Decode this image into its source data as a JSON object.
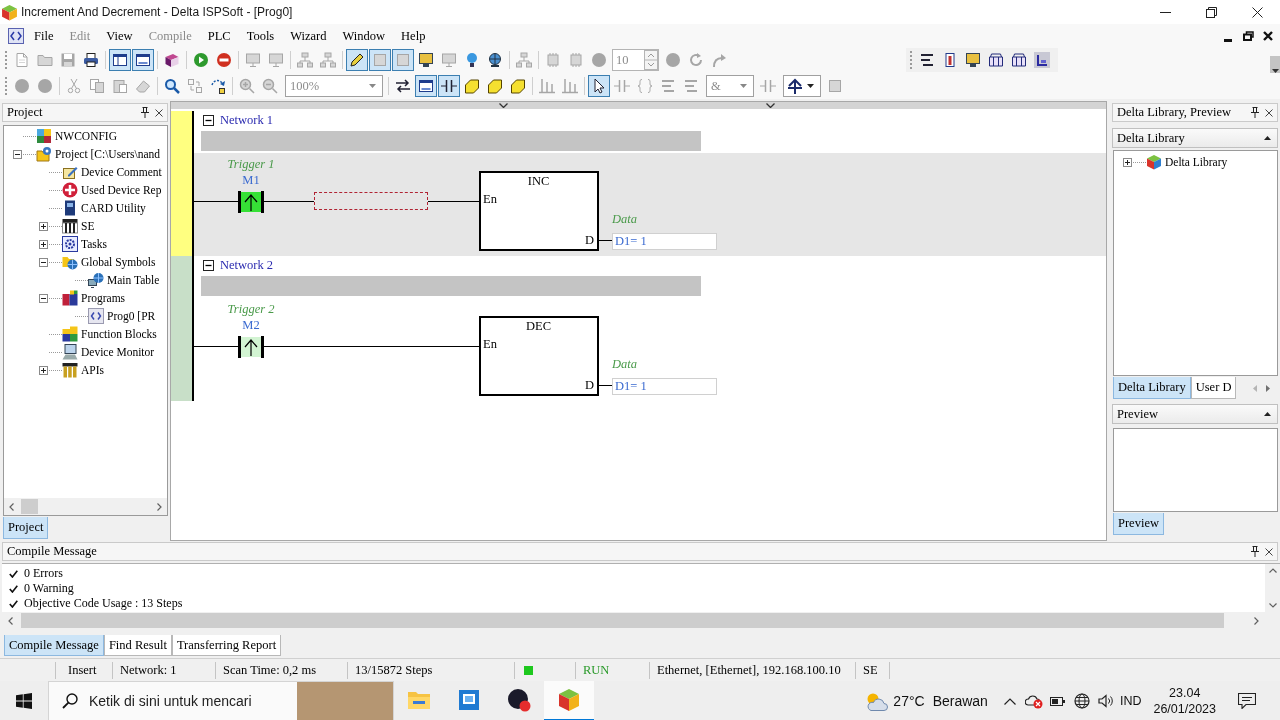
{
  "window": {
    "title": "Increment And Decrement - Delta ISPSoft - [Prog0]"
  },
  "menu": [
    {
      "label": "File",
      "disabled": false
    },
    {
      "label": "Edit",
      "disabled": true
    },
    {
      "label": "View",
      "disabled": false
    },
    {
      "label": "Compile",
      "disabled": true
    },
    {
      "label": "PLC",
      "disabled": false
    },
    {
      "label": "Tools",
      "disabled": false
    },
    {
      "label": "Wizard",
      "disabled": false
    },
    {
      "label": "Window",
      "disabled": false
    },
    {
      "label": "Help",
      "disabled": false
    }
  ],
  "toolbar_rows": [
    {
      "groups": [
        {
          "items": [
            {
              "kind": "button",
              "disabled": true,
              "selected": false
            },
            {
              "kind": "button",
              "disabled": true,
              "selected": false
            },
            {
              "kind": "button",
              "disabled": true,
              "selected": false
            },
            {
              "kind": "button",
              "disabled": false,
              "selected": false
            },
            {
              "kind": "separator"
            },
            {
              "kind": "button",
              "disabled": false,
              "selected": true
            },
            {
              "kind": "button",
              "disabled": false,
              "selected": true
            },
            {
              "kind": "separator"
            },
            {
              "kind": "button",
              "disabled": false,
              "selected": false
            },
            {
              "kind": "separator"
            },
            {
              "kind": "button",
              "disabled": false,
              "selected": false
            },
            {
              "kind": "button",
              "disabled": false,
              "selected": false
            },
            {
              "kind": "separator"
            },
            {
              "kind": "button",
              "disabled": true,
              "selected": false
            },
            {
              "kind": "button",
              "disabled": true,
              "selected": false
            },
            {
              "kind": "separator"
            },
            {
              "kind": "button",
              "disabled": true,
              "selected": false
            },
            {
              "kind": "button",
              "disabled": true,
              "selected": false
            },
            {
              "kind": "separator"
            },
            {
              "kind": "button",
              "disabled": false,
              "selected": true
            },
            {
              "kind": "button",
              "disabled": true,
              "selected": true
            },
            {
              "kind": "button",
              "disabled": true,
              "selected": true
            },
            {
              "kind": "button",
              "disabled": false,
              "selected": false
            },
            {
              "kind": "button",
              "disabled": true,
              "selected": false
            },
            {
              "kind": "button",
              "disabled": false,
              "selected": false
            },
            {
              "kind": "button",
              "disabled": false,
              "selected": false
            },
            {
              "kind": "separator"
            },
            {
              "kind": "button",
              "disabled": true,
              "selected": false
            },
            {
              "kind": "separator"
            },
            {
              "kind": "button",
              "disabled": true,
              "selected": false
            },
            {
              "kind": "button",
              "disabled": true,
              "selected": false
            },
            {
              "kind": "button",
              "disabled": true,
              "selected": false
            },
            {
              "kind": "spin",
              "value": "10",
              "disabled": true
            },
            {
              "kind": "button",
              "disabled": true,
              "selected": false
            },
            {
              "kind": "button",
              "disabled": true,
              "selected": false
            },
            {
              "kind": "button",
              "disabled": true,
              "selected": false
            }
          ]
        },
        {
          "items": [
            {
              "kind": "button",
              "disabled": false,
              "selected": false
            },
            {
              "kind": "button",
              "disabled": false,
              "selected": false
            },
            {
              "kind": "button",
              "disabled": false,
              "selected": false
            },
            {
              "kind": "button",
              "disabled": false,
              "selected": false
            },
            {
              "kind": "button",
              "disabled": false,
              "selected": false
            },
            {
              "kind": "button",
              "disabled": false,
              "selected": false
            }
          ]
        }
      ]
    },
    {
      "groups": [
        {
          "items": [
            {
              "kind": "button",
              "disabled": true,
              "selected": false
            },
            {
              "kind": "button",
              "disabled": true,
              "selected": false
            },
            {
              "kind": "separator"
            },
            {
              "kind": "button",
              "disabled": true,
              "selected": false
            },
            {
              "kind": "button",
              "disabled": true,
              "selected": false
            },
            {
              "kind": "button",
              "disabled": true,
              "selected": false
            },
            {
              "kind": "button",
              "disabled": true,
              "selected": false
            },
            {
              "kind": "separator"
            },
            {
              "kind": "button",
              "disabled": false,
              "selected": false
            },
            {
              "kind": "button",
              "disabled": true,
              "selected": false
            },
            {
              "kind": "button",
              "disabled": false,
              "selected": false
            },
            {
              "kind": "separator"
            },
            {
              "kind": "button",
              "disabled": true,
              "selected": false
            },
            {
              "kind": "button",
              "disabled": true,
              "selected": false
            },
            {
              "kind": "combo",
              "value": "100%",
              "disabled": true
            },
            {
              "kind": "separator"
            },
            {
              "kind": "button",
              "disabled": false,
              "selected": false
            },
            {
              "kind": "button",
              "disabled": false,
              "selected": true
            },
            {
              "kind": "button",
              "disabled": false,
              "selected": true
            },
            {
              "kind": "button",
              "disabled": false,
              "selected": false
            },
            {
              "kind": "button",
              "disabled": false,
              "selected": false
            },
            {
              "kind": "button",
              "disabled": false,
              "selected": false
            },
            {
              "kind": "separator"
            },
            {
              "kind": "button",
              "disabled": true,
              "selected": false
            },
            {
              "kind": "button",
              "disabled": true,
              "selected": false
            },
            {
              "kind": "separator"
            },
            {
              "kind": "button",
              "disabled": false,
              "selected": true
            },
            {
              "kind": "button",
              "disabled": true,
              "selected": false
            },
            {
              "kind": "button",
              "disabled": true,
              "selected": false
            },
            {
              "kind": "button",
              "disabled": true,
              "selected": false
            },
            {
              "kind": "button",
              "disabled": true,
              "selected": false
            },
            {
              "kind": "combo",
              "value": "&",
              "disabled": true
            },
            {
              "kind": "button",
              "disabled": true,
              "selected": false
            },
            {
              "kind": "icon_combo",
              "disabled": false
            },
            {
              "kind": "button",
              "disabled": true,
              "selected": false
            }
          ]
        }
      ]
    }
  ],
  "project_panel": {
    "title": "Project",
    "tree": [
      {
        "kind": "nwconfig",
        "label": "NWCONFIG"
      },
      {
        "kind": "project",
        "label": "Project [C:\\Users\\nand",
        "expanded": true,
        "children": [
          {
            "kind": "comment",
            "label": "Device Comment"
          },
          {
            "kind": "report",
            "label": "Used Device Rep"
          },
          {
            "kind": "card",
            "label": "CARD Utility"
          },
          {
            "kind": "hardware",
            "label": "SE",
            "expanded": false
          },
          {
            "kind": "tasks",
            "label": "Tasks",
            "expanded": false
          },
          {
            "kind": "symbols",
            "label": "Global Symbols",
            "expanded": true,
            "children": [
              {
                "kind": "table",
                "label": "Main Table"
              }
            ]
          },
          {
            "kind": "programs",
            "label": "Programs",
            "expanded": true,
            "children": [
              {
                "kind": "program",
                "label": "Prog0 [PR"
              }
            ]
          },
          {
            "kind": "blocks",
            "label": "Function Blocks"
          },
          {
            "kind": "monitor",
            "label": "Device Monitor"
          },
          {
            "kind": "apis",
            "label": "APIs",
            "expanded": false
          }
        ]
      }
    ],
    "tabs": [
      {
        "label": "Project",
        "selected": true
      }
    ]
  },
  "editor": {
    "networks": [
      {
        "title": "Network 1",
        "expanded": true,
        "selected": true,
        "contact": {
          "label": "Trigger 1",
          "address": "M1",
          "on": true
        },
        "edit_cursor": true,
        "block": {
          "instruction": "INC",
          "input": "En",
          "output": "D",
          "operand_label": "Data",
          "operand_value": "D1= 1"
        }
      },
      {
        "title": "Network 2",
        "expanded": true,
        "selected": false,
        "contact": {
          "label": "Trigger 2",
          "address": "M2",
          "on": false
        },
        "edit_cursor": false,
        "block": {
          "instruction": "DEC",
          "input": "En",
          "output": "D",
          "operand_label": "Data",
          "operand_value": "D1= 1"
        }
      }
    ]
  },
  "library_panel": {
    "title": "Delta Library, Preview",
    "library": {
      "title": "Delta Library",
      "expanded": true,
      "tree": [
        {
          "kind": "library",
          "label": "Delta Library",
          "expanded": false
        }
      ],
      "tabs": [
        {
          "label": "Delta Library",
          "selected": true
        },
        {
          "label": "User D",
          "selected": false
        }
      ]
    },
    "preview": {
      "title": "Preview",
      "expanded": true,
      "tabs": [
        {
          "label": "Preview",
          "selected": true
        }
      ]
    }
  },
  "compile_panel": {
    "title": "Compile Message",
    "messages": [
      {
        "text": "0 Errors"
      },
      {
        "text": "0 Warning"
      },
      {
        "text": "Objective Code Usage : 13 Steps"
      }
    ],
    "tabs": [
      {
        "label": "Compile Message",
        "selected": true
      },
      {
        "label": "Find Result",
        "selected": false
      },
      {
        "label": "Transferring Report",
        "selected": false
      }
    ]
  },
  "status_bar": {
    "cells": [
      {
        "kind": "text",
        "text": "Insert"
      },
      {
        "kind": "text",
        "text": "Network: 1"
      },
      {
        "kind": "text",
        "text": "Scan Time: 0,2 ms"
      },
      {
        "kind": "text",
        "text": "13/15872 Steps"
      },
      {
        "kind": "light",
        "on": true
      },
      {
        "kind": "state",
        "text": "RUN"
      },
      {
        "kind": "text",
        "text": "Ethernet, [Ethernet], 192.168.100.10"
      },
      {
        "kind": "text",
        "text": "SE"
      }
    ]
  },
  "taskbar": {
    "search": {
      "placeholder": "Ketik di sini untuk mencari"
    },
    "apps": [
      {
        "active": false
      },
      {
        "active": false
      },
      {
        "active": false
      },
      {
        "active": true
      }
    ],
    "weather": {
      "temperature": "27°C",
      "condition": "Berawan"
    },
    "language": "IND",
    "time": "23.04",
    "date": "26/01/2023"
  }
}
